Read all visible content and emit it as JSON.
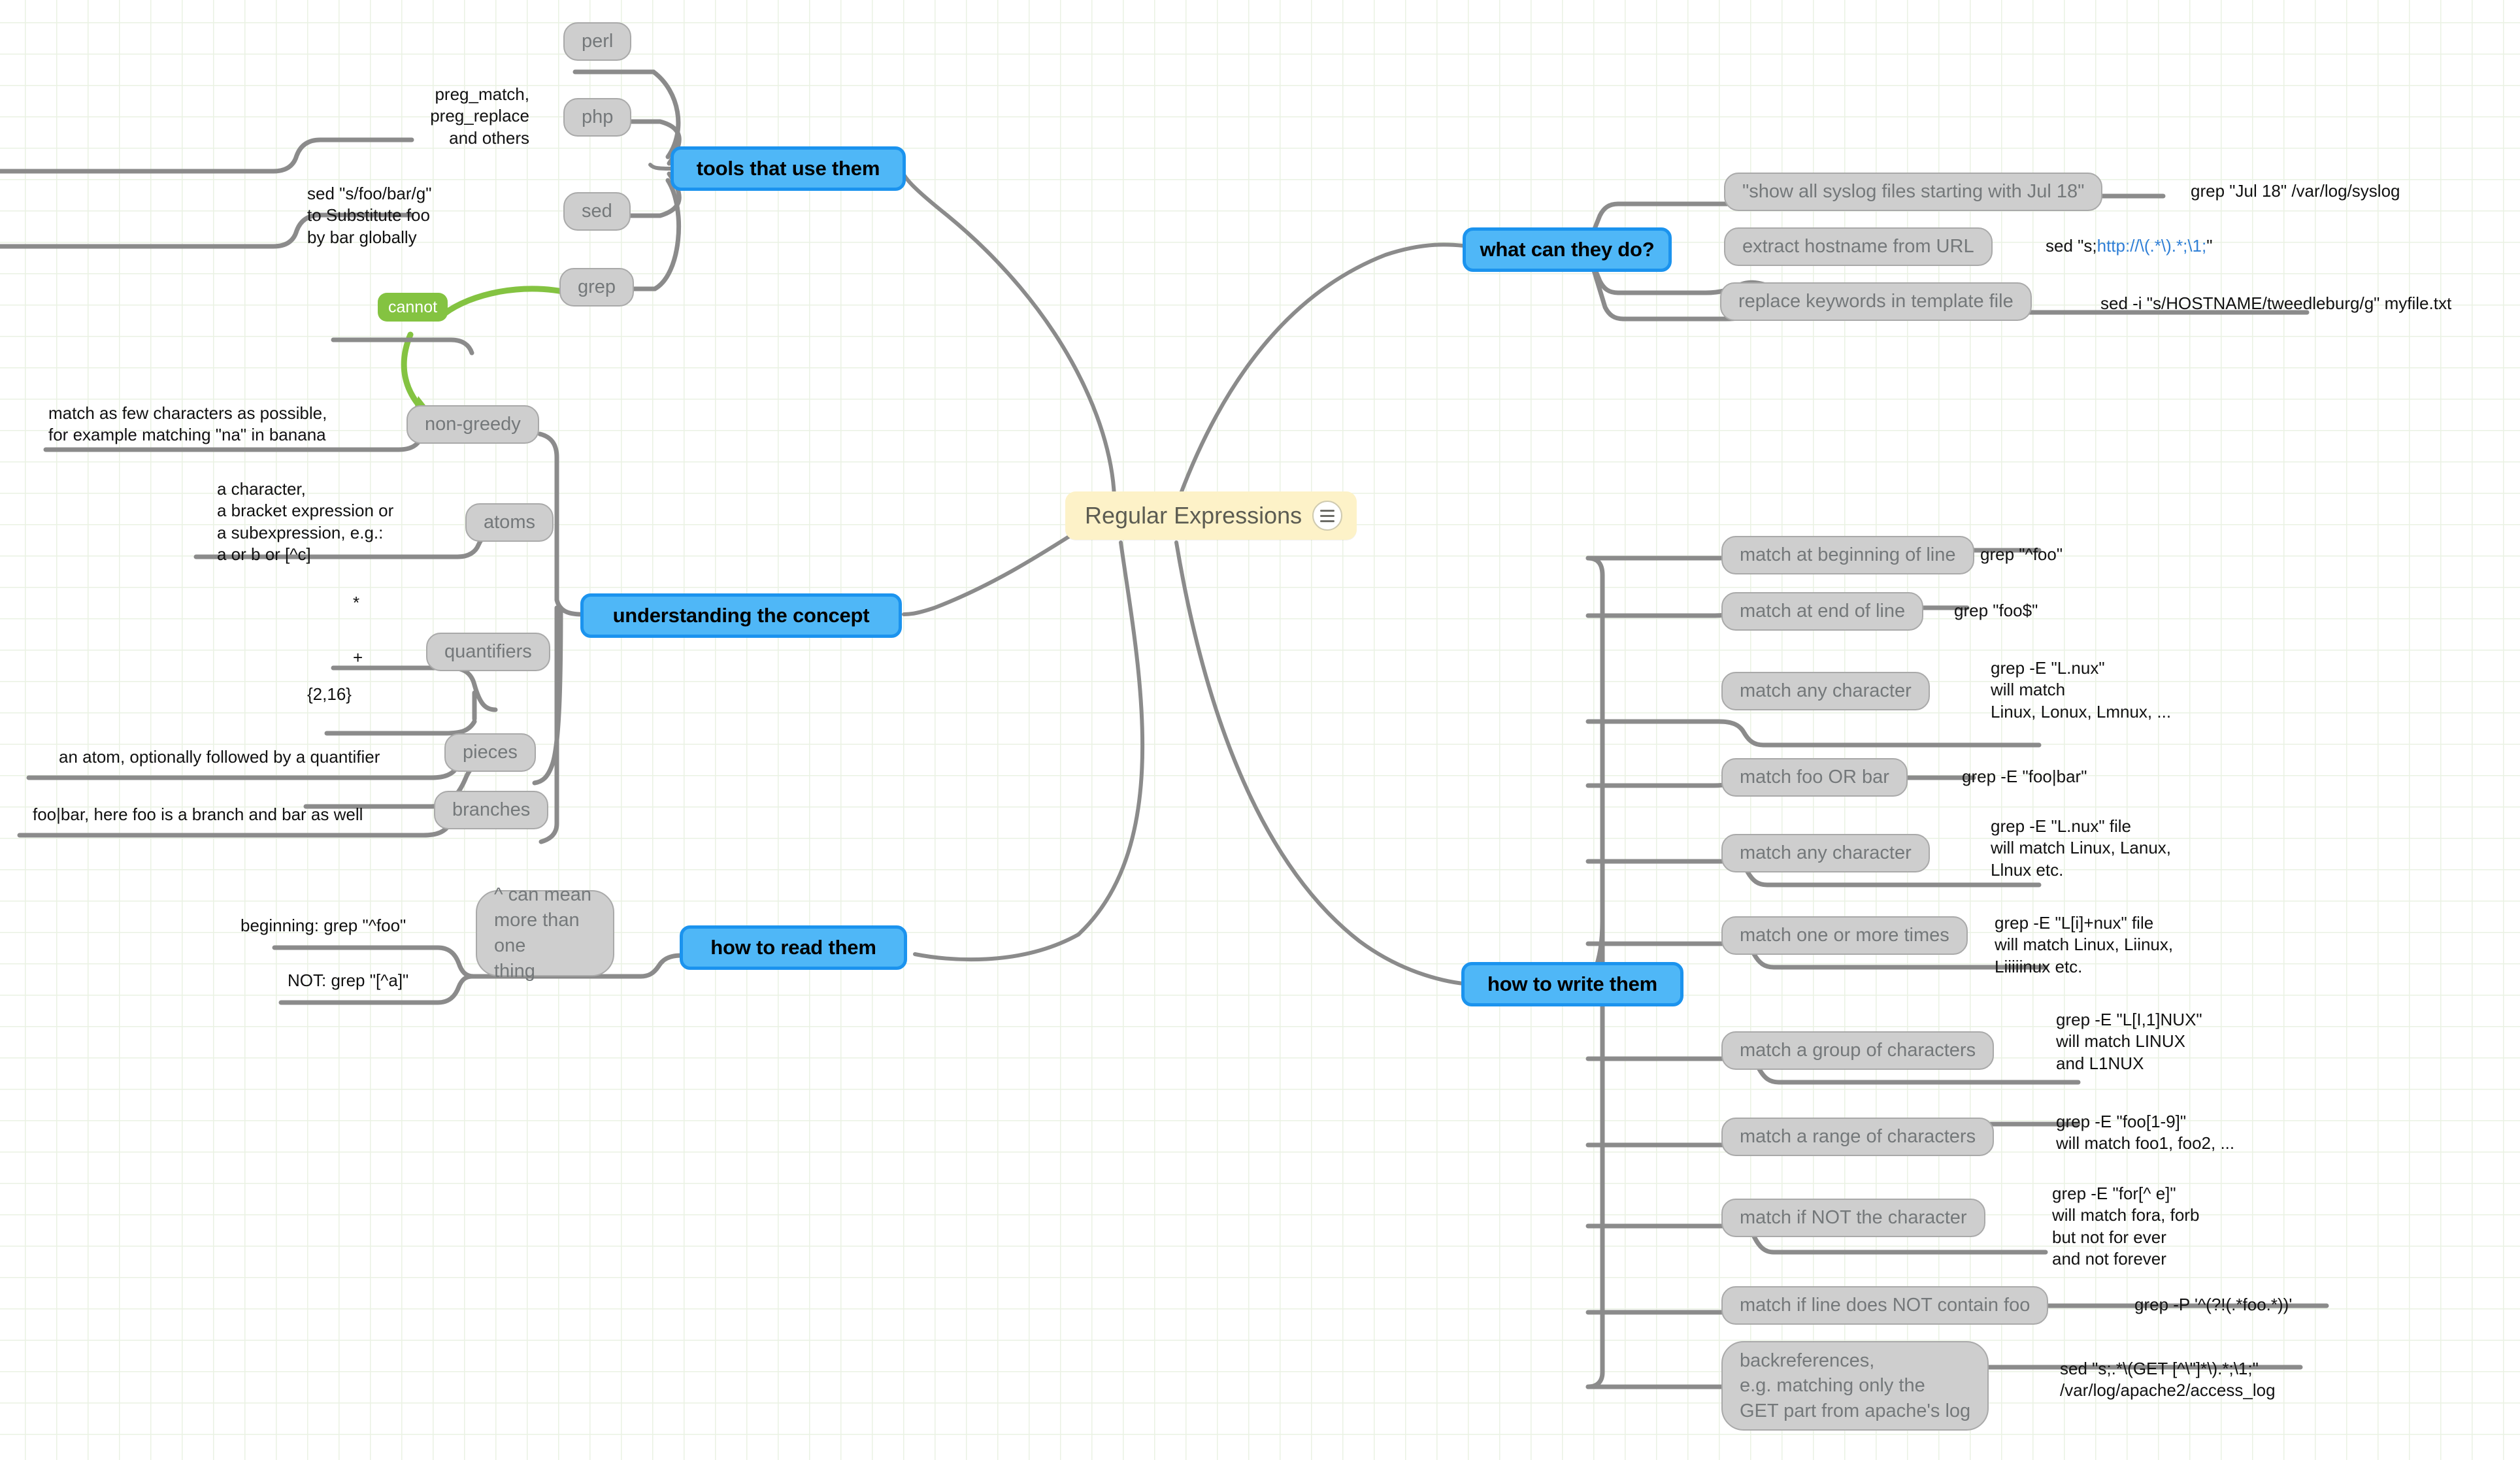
{
  "app": {
    "title": "Regular Expressions",
    "menu_icon": "hamburger-menu-icon",
    "colors": {
      "root_fill": "#fdf2c8",
      "branch_fill": "#4fb7f7",
      "branch_border": "#1b93ee",
      "topic_fill": "#cecece",
      "topic_border": "#a9a9a9",
      "topic_text": "#74787a",
      "relation_fill": "#84c341",
      "wire": "#8b8b8b",
      "link_text": "#2f7fd6",
      "grid": "#eaf2e3"
    }
  },
  "root": {
    "label": "Regular Expressions"
  },
  "branches": {
    "tools": {
      "label": "tools that use them",
      "children": [
        {
          "label": "perl",
          "notes": []
        },
        {
          "label": "php",
          "notes": [
            "preg_match,",
            "preg_replace",
            "and others"
          ]
        },
        {
          "label": "sed",
          "notes": [
            "sed \"s/foo/bar/g\"",
            "to Substitute foo",
            "by bar globally"
          ]
        },
        {
          "label": "grep",
          "notes": []
        }
      ]
    },
    "concept": {
      "label": "understanding the concept",
      "children": [
        {
          "label": "non-greedy",
          "notes": [
            "match as few characters as possible,",
            "for example matching \"na\" in banana"
          ]
        },
        {
          "label": "atoms",
          "notes": [
            "a character,",
            "a bracket expression or",
            "a subexpression, e.g.:",
            "a or b or [^c]"
          ]
        },
        {
          "label": "quantifiers",
          "notes": [
            "*",
            "+",
            "{2,16}"
          ]
        },
        {
          "label": "pieces",
          "notes": [
            "an atom, optionally followed by a quantifier"
          ]
        },
        {
          "label": "branches",
          "notes": [
            "foo|bar, here foo is a branch and bar as well"
          ]
        }
      ]
    },
    "read": {
      "label": "how to read them",
      "children": [
        {
          "label": "^ can mean\nmore than one\nthing",
          "notes": [
            "beginning: grep \"^foo\"",
            "NOT: grep \"[^a]\""
          ]
        }
      ]
    },
    "what": {
      "label": "what can they do?",
      "children": [
        {
          "label": "\"show all syslog files starting with Jul 18\"",
          "notes": [
            "grep \"Jul 18\" /var/log/syslog"
          ]
        },
        {
          "label": "extract hostname from URL",
          "notes": [
            "sed \"s;http://\\(.*\\).*;\\1;\""
          ]
        },
        {
          "label": "replace keywords in template file",
          "notes": [
            "sed -i \"s/HOSTNAME/tweedleburg/g\" myfile.txt"
          ]
        }
      ]
    },
    "write": {
      "label": "how to write them",
      "children": [
        {
          "label": "match at beginning of line",
          "notes": [
            "grep \"^foo\""
          ]
        },
        {
          "label": "match at end of line",
          "notes": [
            "grep \"foo$\""
          ]
        },
        {
          "label": "match any character",
          "notes": [
            "grep -E \"L.nux\"",
            "will match",
            "Linux, Lonux, Lmnux, ..."
          ]
        },
        {
          "label": "match foo OR bar",
          "notes": [
            "grep -E \"foo|bar\""
          ]
        },
        {
          "label": "match any character",
          "notes": [
            "grep -E \"L.nux\" file",
            "will match Linux, Lanux,",
            "Llnux etc."
          ]
        },
        {
          "label": "match one or more times",
          "notes": [
            "grep -E \"L[i]+nux\" file",
            "will match Linux, Liinux,",
            "Liiiiinux etc."
          ]
        },
        {
          "label": "match a group of characters",
          "notes": [
            "grep -E \"L[I,1]NUX\"",
            "will match LINUX",
            "and L1NUX"
          ]
        },
        {
          "label": "match a range of characters",
          "notes": [
            "grep -E \"foo[1-9]\"",
            "will match foo1, foo2, ..."
          ]
        },
        {
          "label": "match if NOT the character",
          "notes": [
            "grep -E \"for[^ e]\"",
            "will match fora, forb",
            "but not for ever",
            "and not forever"
          ]
        },
        {
          "label": "match if line does NOT contain foo",
          "notes": [
            "grep -P '^(?!(.*foo.*))'"
          ]
        },
        {
          "label": "backreferences,\ne.g. matching only the\nGET part from apache's log",
          "notes": [
            "sed \"s;.*\\(GET [^\\\"]*\\).*;\\1;\"",
            "/var/log/apache2/access_log"
          ]
        }
      ]
    }
  },
  "relations": [
    {
      "label": "cannot",
      "from": "grep",
      "to": "non-greedy"
    }
  ],
  "link_fragment": {
    "prefix": "sed \"s;",
    "link": "http://\\(.*\\).*;\\1;",
    "suffix": "\""
  }
}
